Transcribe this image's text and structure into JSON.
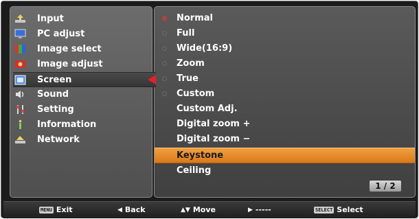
{
  "sidebar": {
    "items": [
      {
        "label": "Input",
        "icon": "input-icon"
      },
      {
        "label": "PC adjust",
        "icon": "pc-adjust-icon"
      },
      {
        "label": "Image select",
        "icon": "image-select-icon"
      },
      {
        "label": "Image adjust",
        "icon": "image-adjust-icon"
      },
      {
        "label": "Screen",
        "icon": "screen-icon",
        "selected": true
      },
      {
        "label": "Sound",
        "icon": "sound-icon"
      },
      {
        "label": "Setting",
        "icon": "setting-icon"
      },
      {
        "label": "Information",
        "icon": "information-icon"
      },
      {
        "label": "Network",
        "icon": "network-icon"
      }
    ]
  },
  "options": {
    "items": [
      {
        "label": "Normal",
        "radio": true,
        "selected": true
      },
      {
        "label": "Full",
        "radio": true
      },
      {
        "label": "Wide(16:9)",
        "radio": true
      },
      {
        "label": "Zoom",
        "radio": true
      },
      {
        "label": "True",
        "radio": true
      },
      {
        "label": "Custom",
        "radio": true
      },
      {
        "label": "Custom Adj."
      },
      {
        "label": "Digital zoom +"
      },
      {
        "label": "Digital zoom −"
      },
      {
        "label": "Keystone",
        "highlighted": true
      },
      {
        "label": "Ceiling"
      }
    ],
    "page_indicator": "1 / 2"
  },
  "bottom_bar": {
    "exit_key": "MENU",
    "exit_label": "Exit",
    "back_label": "Back",
    "move_label": "Move",
    "next_label": "-----",
    "select_key": "SELECT",
    "select_label": "Select"
  },
  "colors": {
    "highlight": "#e08a2a",
    "accent_red": "#e0222a"
  }
}
